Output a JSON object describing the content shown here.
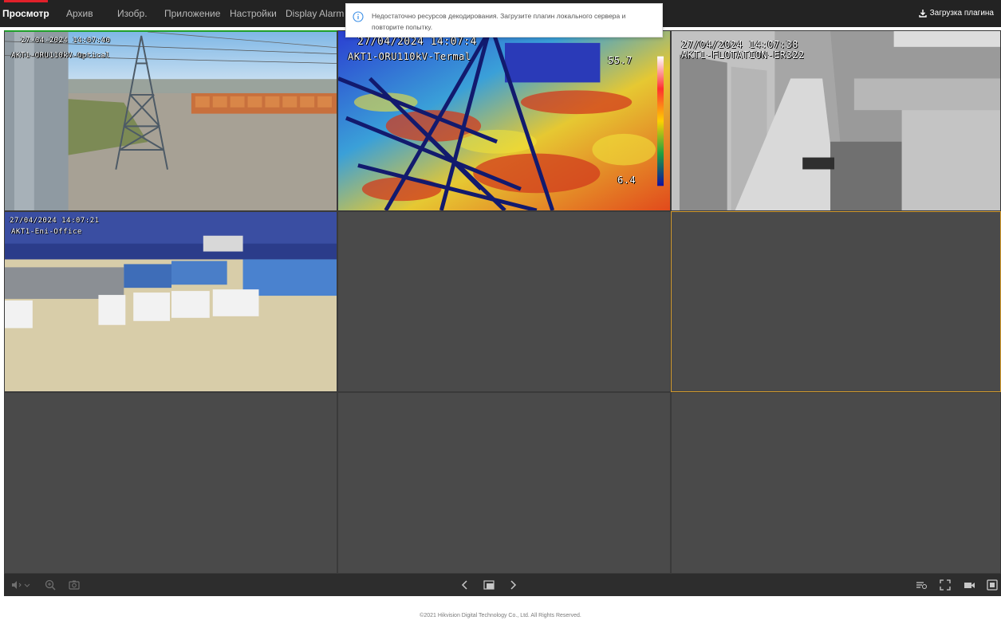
{
  "nav": {
    "items": [
      {
        "label": "Просмотр"
      },
      {
        "label": "Архив"
      },
      {
        "label": "Изобр."
      },
      {
        "label": "Приложение"
      },
      {
        "label": "Настройки"
      },
      {
        "label": "Display Alarm"
      }
    ],
    "plugin_label": "Загрузка плагина"
  },
  "notification": {
    "text": "Недостаточно ресурсов декодирования. Загрузите плагин локального сервера и повторите попытку."
  },
  "cameras": [
    {
      "timestamp": "27-04-2024 14:07:40",
      "name": "AKT1-ORU110kV-Optical"
    },
    {
      "timestamp": "27/04/2024 14:07:4",
      "name": "AKT1-ORU110kV-Termal",
      "temp_max": "55.7",
      "temp_min": "6.4"
    },
    {
      "timestamp": "27/04/2024 14:07:38",
      "name": "AKT1-FLOTATION-ER322"
    },
    {
      "timestamp": "27/04/2024 14:07:21",
      "name": "AKT1-Eni-Office"
    }
  ],
  "footer": {
    "copyright": "©2021 Hikvision Digital Technology Co., Ltd. All Rights Reserved."
  },
  "colors": {
    "accent_red": "#e0202a",
    "selected_border": "#d49b2c",
    "active_border": "#1fa02a"
  }
}
